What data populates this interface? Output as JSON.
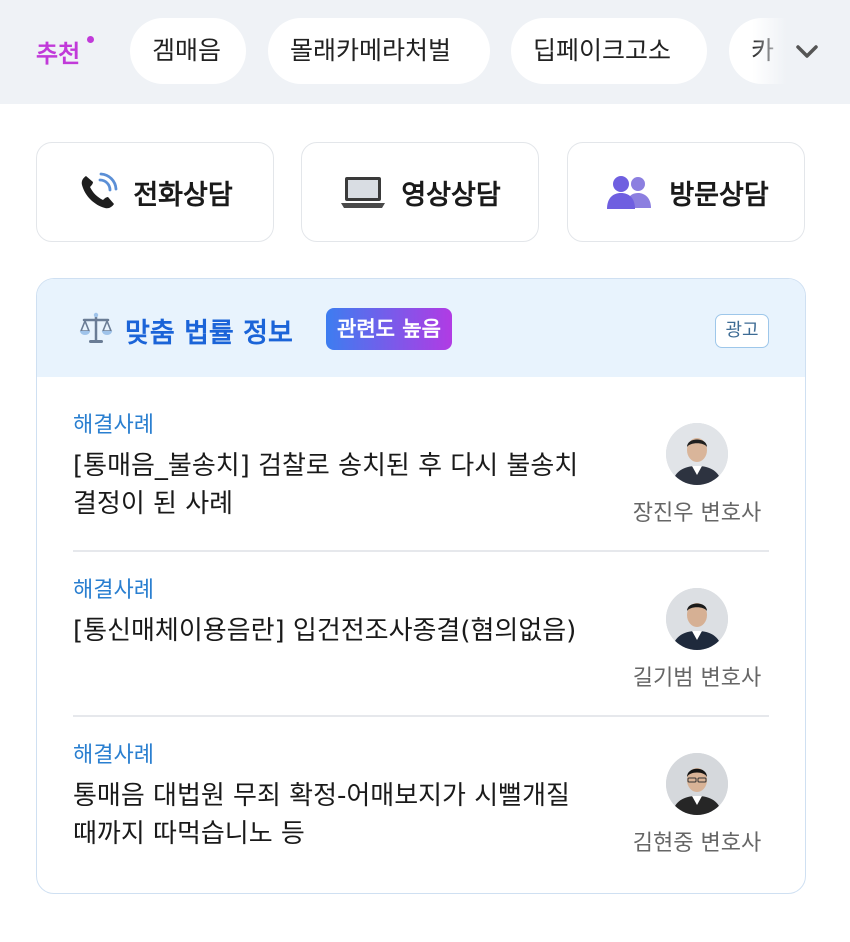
{
  "tags": {
    "recommend": "추천",
    "items": [
      "겜매음",
      "몰래카메라처벌",
      "딥페이크고소",
      "카"
    ]
  },
  "consult": {
    "phone": "전화상담",
    "video": "영상상담",
    "visit": "방문상담"
  },
  "info": {
    "title": "맞춤 법률 정보",
    "badge": "관련도 높음",
    "ad": "광고",
    "items": [
      {
        "category": "해결사례",
        "title": "[통매음_불송치] 검찰로 송치된 후 다시 불송치 결정이 된 사례",
        "lawyer": "장진우 변호사"
      },
      {
        "category": "해결사례",
        "title": "[통신매체이용음란] 입건전조사종결(혐의없음)",
        "lawyer": "길기범 변호사"
      },
      {
        "category": "해결사례",
        "title": "통매음 대법원 무죄 확정-어매보지가 시뻘개질때까지 따먹습니노 등",
        "lawyer": "김현중 변호사"
      }
    ]
  },
  "colors": {
    "recommend": "#c13ad9",
    "title_blue": "#1b64d8",
    "category_blue": "#2a7fd0",
    "badge_start": "#3d7df0",
    "badge_end": "#b13be4"
  }
}
